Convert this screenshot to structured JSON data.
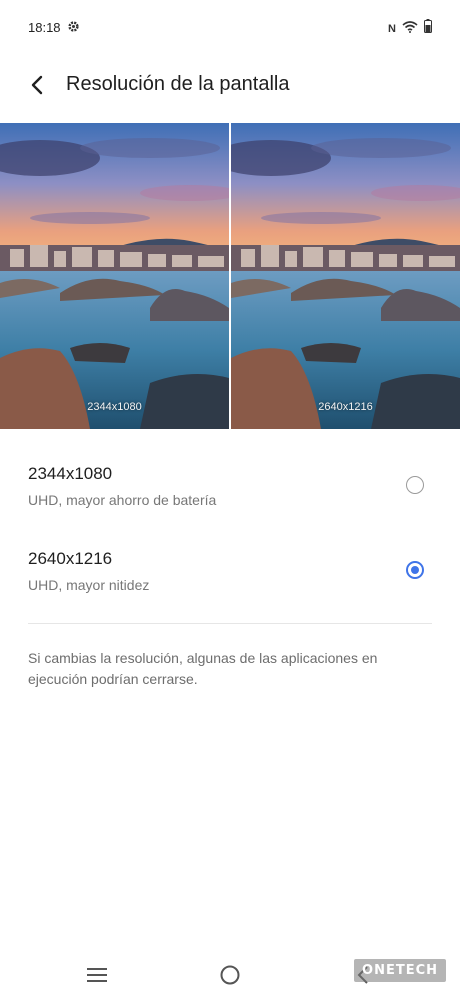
{
  "status": {
    "time": "18:18",
    "icons": [
      "gear-icon",
      "nfc-icon",
      "wifi-icon",
      "battery-icon"
    ],
    "nfc_text": "N"
  },
  "header": {
    "title": "Resolución de la pantalla",
    "back_icon": "back-arrow-icon"
  },
  "preview": {
    "left_label": "2344x1080",
    "right_label": "2640x1216"
  },
  "options": [
    {
      "title": "2344x1080",
      "subtitle": "UHD, mayor ahorro de batería",
      "selected": false
    },
    {
      "title": "2640x1216",
      "subtitle": "UHD, mayor nitidez",
      "selected": true
    }
  ],
  "note": "Si cambias la resolución, algunas de las aplicaciones en ejecución podrían cerrarse.",
  "nav": {
    "icons": [
      "menu-icon",
      "home-icon",
      "back-icon"
    ]
  },
  "watermark": "ONETECH",
  "colors": {
    "accent": "#3f74e8",
    "radio_off": "#9a9a9a"
  }
}
